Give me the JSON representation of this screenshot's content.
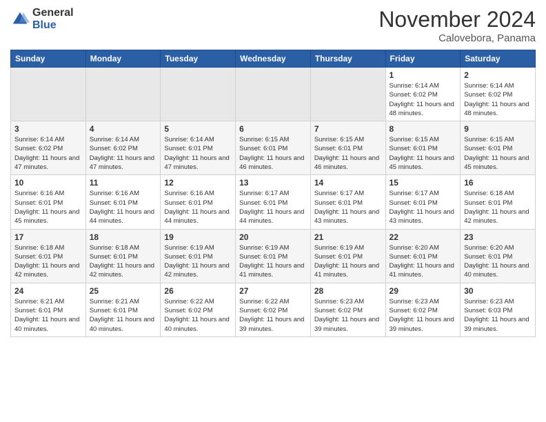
{
  "header": {
    "logo_general": "General",
    "logo_blue": "Blue",
    "month_title": "November 2024",
    "subtitle": "Calovebora, Panama"
  },
  "weekdays": [
    "Sunday",
    "Monday",
    "Tuesday",
    "Wednesday",
    "Thursday",
    "Friday",
    "Saturday"
  ],
  "weeks": [
    [
      {
        "day": "",
        "empty": true
      },
      {
        "day": "",
        "empty": true
      },
      {
        "day": "",
        "empty": true
      },
      {
        "day": "",
        "empty": true
      },
      {
        "day": "",
        "empty": true
      },
      {
        "day": "1",
        "sunrise": "Sunrise: 6:14 AM",
        "sunset": "Sunset: 6:02 PM",
        "daylight": "Daylight: 11 hours and 48 minutes."
      },
      {
        "day": "2",
        "sunrise": "Sunrise: 6:14 AM",
        "sunset": "Sunset: 6:02 PM",
        "daylight": "Daylight: 11 hours and 48 minutes."
      }
    ],
    [
      {
        "day": "3",
        "sunrise": "Sunrise: 6:14 AM",
        "sunset": "Sunset: 6:02 PM",
        "daylight": "Daylight: 11 hours and 47 minutes."
      },
      {
        "day": "4",
        "sunrise": "Sunrise: 6:14 AM",
        "sunset": "Sunset: 6:02 PM",
        "daylight": "Daylight: 11 hours and 47 minutes."
      },
      {
        "day": "5",
        "sunrise": "Sunrise: 6:14 AM",
        "sunset": "Sunset: 6:01 PM",
        "daylight": "Daylight: 11 hours and 47 minutes."
      },
      {
        "day": "6",
        "sunrise": "Sunrise: 6:15 AM",
        "sunset": "Sunset: 6:01 PM",
        "daylight": "Daylight: 11 hours and 46 minutes."
      },
      {
        "day": "7",
        "sunrise": "Sunrise: 6:15 AM",
        "sunset": "Sunset: 6:01 PM",
        "daylight": "Daylight: 11 hours and 46 minutes."
      },
      {
        "day": "8",
        "sunrise": "Sunrise: 6:15 AM",
        "sunset": "Sunset: 6:01 PM",
        "daylight": "Daylight: 11 hours and 45 minutes."
      },
      {
        "day": "9",
        "sunrise": "Sunrise: 6:15 AM",
        "sunset": "Sunset: 6:01 PM",
        "daylight": "Daylight: 11 hours and 45 minutes."
      }
    ],
    [
      {
        "day": "10",
        "sunrise": "Sunrise: 6:16 AM",
        "sunset": "Sunset: 6:01 PM",
        "daylight": "Daylight: 11 hours and 45 minutes."
      },
      {
        "day": "11",
        "sunrise": "Sunrise: 6:16 AM",
        "sunset": "Sunset: 6:01 PM",
        "daylight": "Daylight: 11 hours and 44 minutes."
      },
      {
        "day": "12",
        "sunrise": "Sunrise: 6:16 AM",
        "sunset": "Sunset: 6:01 PM",
        "daylight": "Daylight: 11 hours and 44 minutes."
      },
      {
        "day": "13",
        "sunrise": "Sunrise: 6:17 AM",
        "sunset": "Sunset: 6:01 PM",
        "daylight": "Daylight: 11 hours and 44 minutes."
      },
      {
        "day": "14",
        "sunrise": "Sunrise: 6:17 AM",
        "sunset": "Sunset: 6:01 PM",
        "daylight": "Daylight: 11 hours and 43 minutes."
      },
      {
        "day": "15",
        "sunrise": "Sunrise: 6:17 AM",
        "sunset": "Sunset: 6:01 PM",
        "daylight": "Daylight: 11 hours and 43 minutes."
      },
      {
        "day": "16",
        "sunrise": "Sunrise: 6:18 AM",
        "sunset": "Sunset: 6:01 PM",
        "daylight": "Daylight: 11 hours and 42 minutes."
      }
    ],
    [
      {
        "day": "17",
        "sunrise": "Sunrise: 6:18 AM",
        "sunset": "Sunset: 6:01 PM",
        "daylight": "Daylight: 11 hours and 42 minutes."
      },
      {
        "day": "18",
        "sunrise": "Sunrise: 6:18 AM",
        "sunset": "Sunset: 6:01 PM",
        "daylight": "Daylight: 11 hours and 42 minutes."
      },
      {
        "day": "19",
        "sunrise": "Sunrise: 6:19 AM",
        "sunset": "Sunset: 6:01 PM",
        "daylight": "Daylight: 11 hours and 42 minutes."
      },
      {
        "day": "20",
        "sunrise": "Sunrise: 6:19 AM",
        "sunset": "Sunset: 6:01 PM",
        "daylight": "Daylight: 11 hours and 41 minutes."
      },
      {
        "day": "21",
        "sunrise": "Sunrise: 6:19 AM",
        "sunset": "Sunset: 6:01 PM",
        "daylight": "Daylight: 11 hours and 41 minutes."
      },
      {
        "day": "22",
        "sunrise": "Sunrise: 6:20 AM",
        "sunset": "Sunset: 6:01 PM",
        "daylight": "Daylight: 11 hours and 41 minutes."
      },
      {
        "day": "23",
        "sunrise": "Sunrise: 6:20 AM",
        "sunset": "Sunset: 6:01 PM",
        "daylight": "Daylight: 11 hours and 40 minutes."
      }
    ],
    [
      {
        "day": "24",
        "sunrise": "Sunrise: 6:21 AM",
        "sunset": "Sunset: 6:01 PM",
        "daylight": "Daylight: 11 hours and 40 minutes."
      },
      {
        "day": "25",
        "sunrise": "Sunrise: 6:21 AM",
        "sunset": "Sunset: 6:01 PM",
        "daylight": "Daylight: 11 hours and 40 minutes."
      },
      {
        "day": "26",
        "sunrise": "Sunrise: 6:22 AM",
        "sunset": "Sunset: 6:02 PM",
        "daylight": "Daylight: 11 hours and 40 minutes."
      },
      {
        "day": "27",
        "sunrise": "Sunrise: 6:22 AM",
        "sunset": "Sunset: 6:02 PM",
        "daylight": "Daylight: 11 hours and 39 minutes."
      },
      {
        "day": "28",
        "sunrise": "Sunrise: 6:23 AM",
        "sunset": "Sunset: 6:02 PM",
        "daylight": "Daylight: 11 hours and 39 minutes."
      },
      {
        "day": "29",
        "sunrise": "Sunrise: 6:23 AM",
        "sunset": "Sunset: 6:02 PM",
        "daylight": "Daylight: 11 hours and 39 minutes."
      },
      {
        "day": "30",
        "sunrise": "Sunrise: 6:23 AM",
        "sunset": "Sunset: 6:03 PM",
        "daylight": "Daylight: 11 hours and 39 minutes."
      }
    ]
  ]
}
